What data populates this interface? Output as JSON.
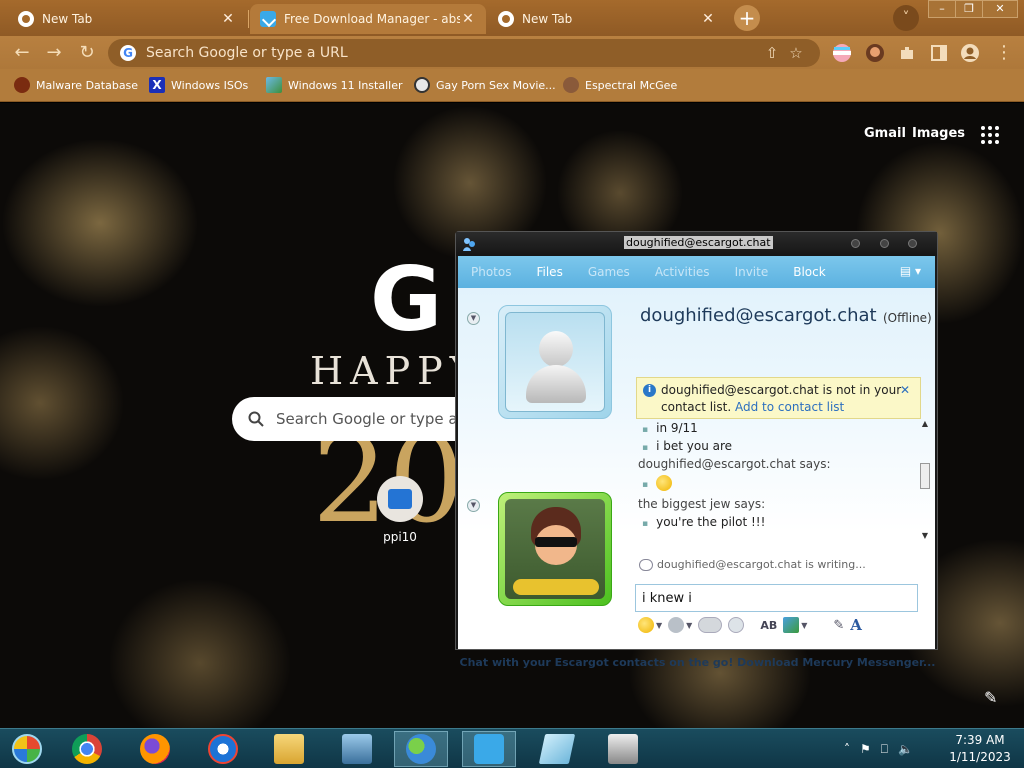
{
  "browser": {
    "tabs": [
      {
        "title": "New Tab",
        "active": false
      },
      {
        "title": "Free Download Manager - absolut",
        "active": true
      },
      {
        "title": "New Tab",
        "active": false
      }
    ],
    "new_tab_symbol": "+",
    "tab_search_symbol": "˅",
    "window_controls": {
      "minimize": "–",
      "restore": "❐",
      "close": "✕"
    },
    "nav": {
      "back": "←",
      "forward": "→",
      "reload": "↻"
    },
    "omnibox_placeholder": "Search Google or type a URL",
    "omnibox_actions": {
      "share": "⇧",
      "star": "☆"
    },
    "bookmarks": [
      {
        "label": "Malware Database",
        "icon": "malware-icon"
      },
      {
        "label": "Windows ISOs",
        "icon": "x-icon"
      },
      {
        "label": "Windows 11 Installer",
        "icon": "image-icon"
      },
      {
        "label": "Gay Porn Sex Movie...",
        "icon": "globe-icon"
      },
      {
        "label": "Espectral McGee",
        "icon": "face-icon"
      }
    ],
    "theme_colors": {
      "frame": "#a56a2c",
      "toolbar": "#b88040",
      "omnibox": "#8f5e28"
    }
  },
  "ntp": {
    "gmail": "Gmail",
    "images": "Images",
    "doodle_letter": "G",
    "doodle_happy": "HAPPY",
    "doodle_year": "20",
    "search_placeholder": "Search Google or type a",
    "shortcut_label": "ppi10",
    "edit_symbol": "✎"
  },
  "chat": {
    "window_title": "doughified@escargot.chat",
    "menu": [
      {
        "label": "Photos",
        "enabled": false
      },
      {
        "label": "Files",
        "enabled": true
      },
      {
        "label": "Games",
        "enabled": false
      },
      {
        "label": "Activities",
        "enabled": false
      },
      {
        "label": "Invite",
        "enabled": false
      },
      {
        "label": "Block",
        "enabled": true
      }
    ],
    "menu_more": "▤ ▾",
    "contact_name": "doughified@escargot.chat",
    "contact_status": "(Offline)",
    "notice": {
      "text": "doughified@escargot.chat is not in your contact list.",
      "link": "Add to contact list",
      "close": "✕"
    },
    "transcript": [
      {
        "kind": "msg",
        "text": "in 9/11"
      },
      {
        "kind": "msg",
        "text": "i bet you are"
      },
      {
        "kind": "says",
        "text": "doughified@escargot.chat says:"
      },
      {
        "kind": "emoticon",
        "text": ""
      },
      {
        "kind": "says",
        "text": "the biggest jew says:"
      },
      {
        "kind": "msg",
        "text": "you're the pilot !!!"
      }
    ],
    "typing_status": "doughified@escargot.chat is writing...",
    "input_value": "i knew i",
    "format_bar": [
      "emoticon-icon",
      "wink-icon",
      "nudge-icon",
      "voice-clip-icon",
      "font-icon",
      "background-icon",
      "handwriting-icon",
      "text-style-icon"
    ],
    "footer": "Chat with your Escargot contacts on the go! Download Mercury Messenger..."
  },
  "taskbar": {
    "items": [
      "start-orb",
      "chrome-icon",
      "firefox-icon",
      "ie-icon",
      "file-explorer-icon",
      "network-computer-icon",
      "messenger-icon",
      "download-manager-icon",
      "notepad-icon",
      "printer-icon"
    ],
    "tray": {
      "chevron": "˄",
      "flag": "⚑",
      "network": "⎕",
      "volume": "🔈"
    },
    "time": "7:39 AM",
    "date": "1/11/2023"
  }
}
